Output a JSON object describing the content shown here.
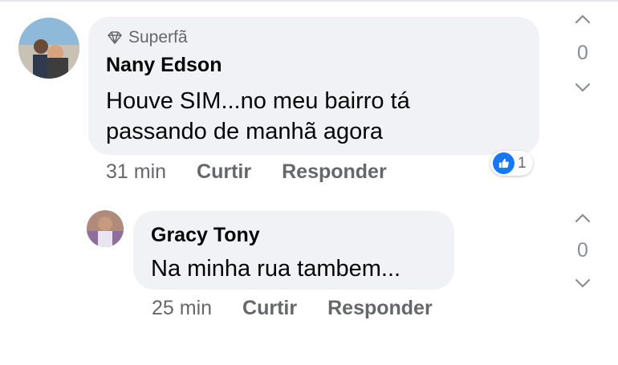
{
  "comments": [
    {
      "badge": "Superfã",
      "author": "Nany Edson",
      "text_lines": [
        "Houve SIM...no meu bairro tá",
        "passando de manhã  agora"
      ],
      "time": "31 min",
      "like_label": "Curtir",
      "reply_label": "Responder",
      "reaction_count": "1",
      "vote_count": "0"
    },
    {
      "author": "Gracy Tony",
      "text_lines": [
        "Na minha rua tambem..."
      ],
      "time": "25 min",
      "like_label": "Curtir",
      "reply_label": "Responder",
      "vote_count": "0"
    }
  ],
  "colors": {
    "bubble": "#f0f2f5",
    "meta_text": "#65676b",
    "like_blue": "#1877f2",
    "vote_gray": "#8a8d91"
  },
  "icons": {
    "badge": "diamond-icon",
    "reaction": "like-thumb-icon",
    "vote_up": "chevron-up-icon",
    "vote_down": "chevron-down-icon"
  }
}
